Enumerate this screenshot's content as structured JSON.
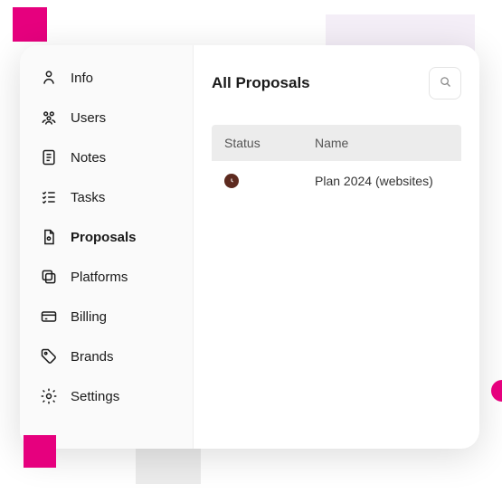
{
  "sidebar": {
    "items": [
      {
        "label": "Info",
        "icon": "person-icon",
        "active": false
      },
      {
        "label": "Users",
        "icon": "users-icon",
        "active": false
      },
      {
        "label": "Notes",
        "icon": "notes-icon",
        "active": false
      },
      {
        "label": "Tasks",
        "icon": "tasks-icon",
        "active": false
      },
      {
        "label": "Proposals",
        "icon": "proposals-icon",
        "active": true
      },
      {
        "label": "Platforms",
        "icon": "platforms-icon",
        "active": false
      },
      {
        "label": "Billing",
        "icon": "billing-icon",
        "active": false
      },
      {
        "label": "Brands",
        "icon": "brands-icon",
        "active": false
      },
      {
        "label": "Settings",
        "icon": "settings-icon",
        "active": false
      }
    ]
  },
  "main": {
    "title": "All Proposals",
    "columns": {
      "status": "Status",
      "name": "Name"
    },
    "rows": [
      {
        "status": "pending",
        "status_color": "#5d2a1f",
        "name": "Plan 2024 (websites)"
      }
    ]
  }
}
